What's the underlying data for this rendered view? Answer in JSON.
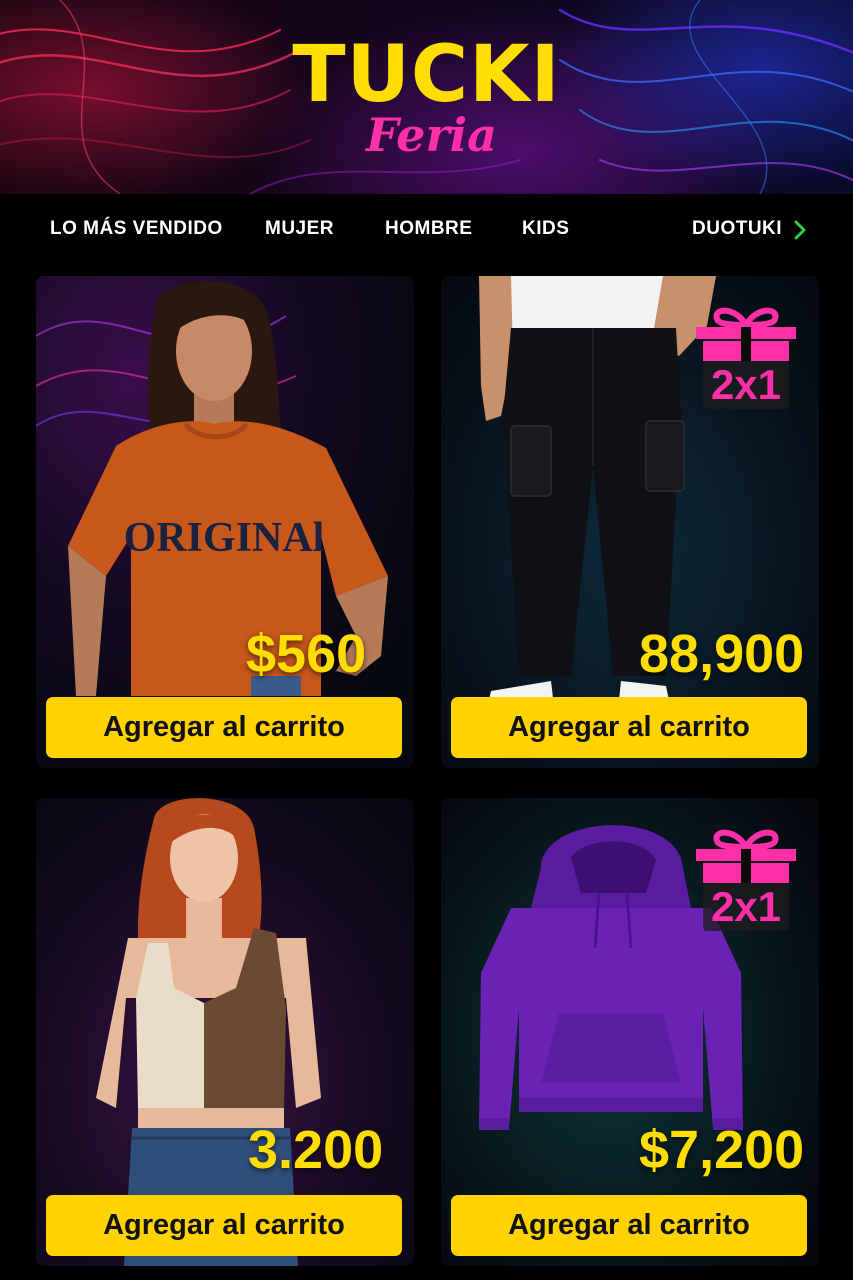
{
  "brand": {
    "name": "TUCKI",
    "tagline": "Feria"
  },
  "nav": {
    "items": [
      "LO MÁS VENDIDO",
      "MUJER",
      "HOMBRE",
      "KIDS",
      "DUOTUKI"
    ],
    "more_icon": "chevron-right-icon"
  },
  "products": [
    {
      "image": "woman in orange ORIGINAL t-shirt",
      "shirt_print": "ORIGINAl",
      "price": "$560",
      "button": "Agregar al carrito",
      "promo": null
    },
    {
      "image": "black cargo pants",
      "price": "88,900",
      "button": "Agregar al carrito",
      "promo": "2x1",
      "promo_icon": "gift-icon"
    },
    {
      "image": "two-tone crop tank top",
      "price": "3.200",
      "button": "Agregar al carrito",
      "promo": null
    },
    {
      "image": "purple hoodie",
      "price": "$7,200",
      "button": "Agregar al carrito",
      "promo": "2x1",
      "promo_icon": "gift-icon"
    }
  ],
  "colors": {
    "accent_yellow": "#ffd200",
    "accent_pink": "#ff2fa8",
    "background": "#000000"
  }
}
